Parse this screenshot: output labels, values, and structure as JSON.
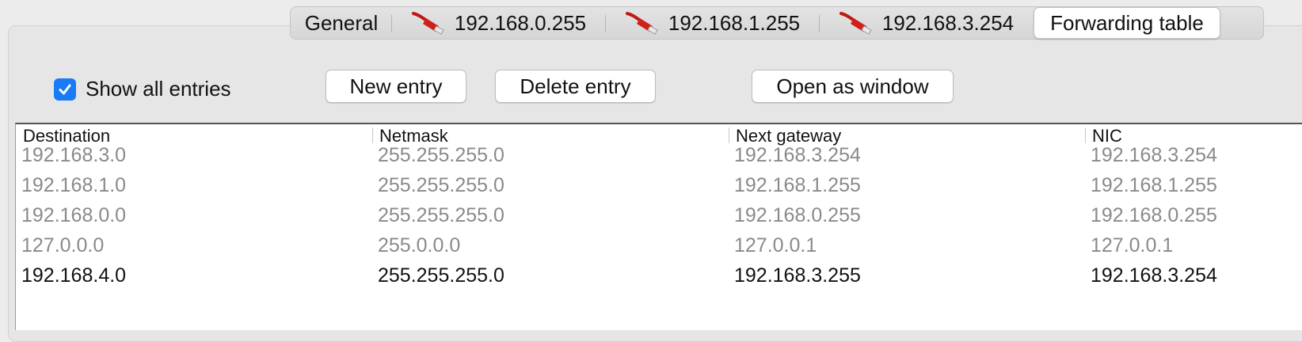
{
  "tabs": [
    {
      "label": "General",
      "icon": null,
      "active": false
    },
    {
      "label": "192.168.0.255",
      "icon": "network-cable-icon",
      "active": false
    },
    {
      "label": "192.168.1.255",
      "icon": "network-cable-icon",
      "active": false
    },
    {
      "label": "192.168.3.254",
      "icon": "network-cable-icon",
      "active": false
    },
    {
      "label": "Forwarding table",
      "icon": null,
      "active": true
    }
  ],
  "controls": {
    "show_all_label": "Show all entries",
    "show_all_checked": true,
    "new_entry": "New entry",
    "delete_entry": "Delete entry",
    "open_window": "Open as window"
  },
  "table": {
    "headers": [
      "Destination",
      "Netmask",
      "Next gateway",
      "NIC"
    ],
    "rows": [
      {
        "style": "dim",
        "cells": [
          "192.168.3.0",
          "255.255.255.0",
          "192.168.3.254",
          "192.168.3.254"
        ]
      },
      {
        "style": "dim",
        "cells": [
          "192.168.1.0",
          "255.255.255.0",
          "192.168.1.255",
          "192.168.1.255"
        ]
      },
      {
        "style": "dim",
        "cells": [
          "192.168.0.0",
          "255.255.255.0",
          "192.168.0.255",
          "192.168.0.255"
        ]
      },
      {
        "style": "dim",
        "cells": [
          "127.0.0.0",
          "255.0.0.0",
          "127.0.0.1",
          "127.0.0.1"
        ]
      },
      {
        "style": "normal",
        "cells": [
          "192.168.4.0",
          "255.255.255.0",
          "192.168.3.255",
          "192.168.3.254"
        ]
      }
    ]
  },
  "colors": {
    "accent": "#1a7cf5",
    "dim_text": "#8a8a8a",
    "icon_red": "#d0201a"
  }
}
